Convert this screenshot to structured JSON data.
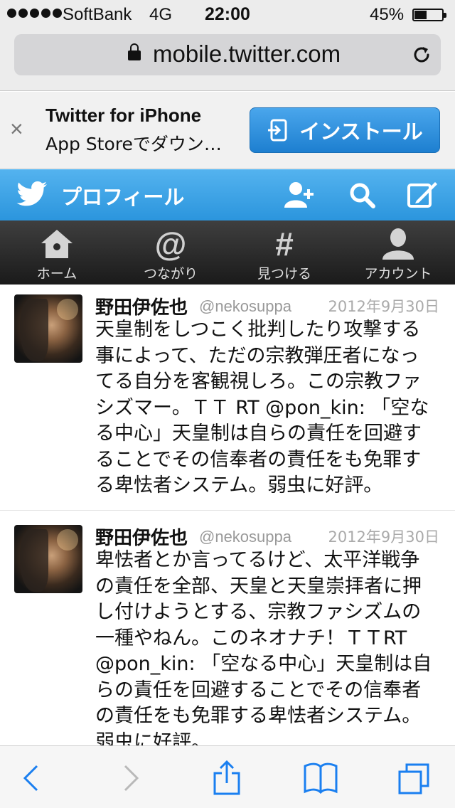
{
  "status_bar": {
    "carrier": "SoftBank",
    "network": "4G",
    "time": "22:00",
    "battery_percent_label": "45%",
    "battery_level": 0.45
  },
  "browser": {
    "url": "mobile.twitter.com",
    "icons": {
      "secure": "lock-icon",
      "reload": "reload-icon"
    }
  },
  "app_banner": {
    "close_label": "×",
    "title": "Twitter for iPhone",
    "subtitle": "App Storeでダウン…",
    "install_label": "インストール"
  },
  "header": {
    "title": "プロフィール",
    "icons": [
      "follow-icon",
      "search-icon",
      "compose-icon"
    ]
  },
  "nav": {
    "items": [
      {
        "label": "ホーム",
        "icon": "home-icon"
      },
      {
        "label": "つながり",
        "icon": "at-icon",
        "glyph": "@"
      },
      {
        "label": "見つける",
        "icon": "hash-icon",
        "glyph": "#"
      },
      {
        "label": "アカウント",
        "icon": "account-icon"
      }
    ]
  },
  "tweets": [
    {
      "name": "野田伊佐也",
      "handle": "@nekosuppa",
      "date": "2012年9月30日",
      "lines": [
        "天皇制をしつこく批判したり攻撃する",
        "事によって、ただの宗教弾圧者になっ",
        "てる自分を客観視しろ。この宗教ファ",
        "シズマー。ＴＴ RT @pon_kin: 「空な",
        "る中心」天皇制は自らの責任を回避す",
        "ることでその信奉者の責任をも免罪す",
        "る卑怯者システム。弱虫に好評。"
      ]
    },
    {
      "name": "野田伊佐也",
      "handle": "@nekosuppa",
      "date": "2012年9月30日",
      "lines": [
        "卑怯者とか言ってるけど、太平洋戦争",
        "の責任を全部、天皇と天皇崇拝者に押",
        "し付けようとする、宗教ファシズムの",
        "一種やねん。このネオナチ！ＴＴRT",
        "@pon_kin: 「空なる中心」天皇制は自",
        "らの責任を回避することでその信奉者",
        "の責任をも免罪する卑怯者システム。",
        "弱虫に好評。"
      ]
    }
  ],
  "toolbar": {
    "icons": [
      "back-icon",
      "forward-icon",
      "share-icon",
      "bookmarks-icon",
      "tabs-icon"
    ]
  },
  "colors": {
    "twitter_blue": "#2b95dd",
    "install_blue": "#1d7fd0",
    "nav_dark": "#1a1a1a",
    "safari_blue": "#1a7ff0"
  }
}
